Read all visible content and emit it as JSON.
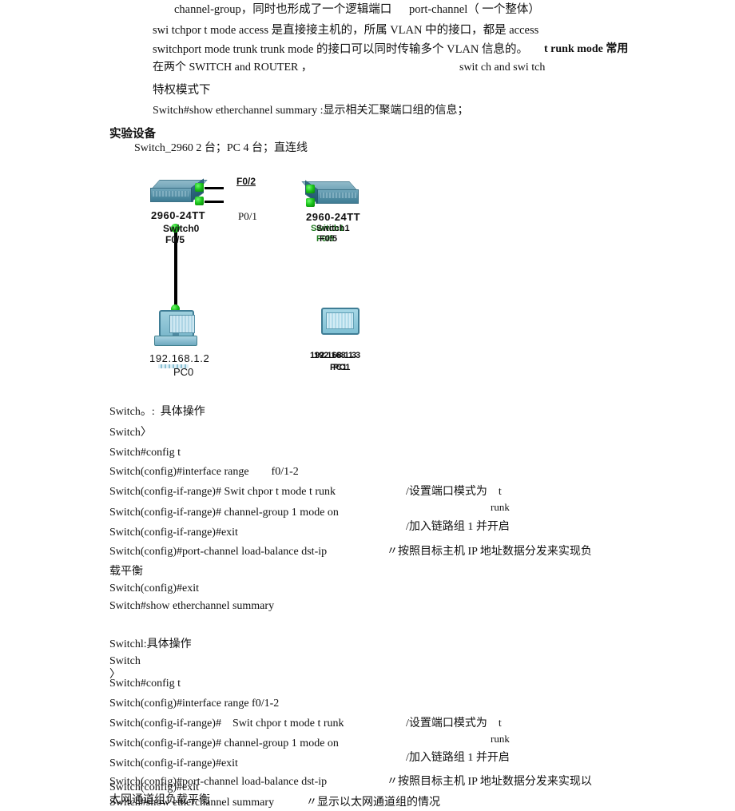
{
  "document": {
    "intro_paragraph": [
      {
        "id": "p1",
        "text": "channel-group，同时也形成了一个逻辑端口      port-channel（ 一个整体）"
      },
      {
        "id": "p2",
        "text": "swi tchpor t mode access 是直接接主机的，所属 VLAN 中的接口，都是 access"
      },
      {
        "id": "p3a",
        "text": "switchport mode trunk trunk mode 的接口可以同时传输多个 VLAN 信息的。"
      },
      {
        "id": "p3b",
        "text": "t runk mode 常用"
      },
      {
        "id": "p4a",
        "text": "在两个 SWITCH and ROUTER ，"
      },
      {
        "id": "p4b",
        "text": "swit ch and swi tch"
      },
      {
        "id": "p5",
        "text": "特权模式下"
      },
      {
        "id": "p6",
        "text": "Switch#show etherchannel summary :显示相关汇聚端口组的信息；"
      }
    ],
    "equipment_heading": "实验设备",
    "equipment_list": "Switch_2960 2 台；PC 4 台；直连线"
  },
  "diagram": {
    "link_labels": {
      "f0_2": "F0/2",
      "p0_1": "P0/1"
    },
    "switch0": {
      "model": "2960-24TT",
      "name": "Switch0",
      "port": "F0/5"
    },
    "switch1": {
      "model": "2960-24TT",
      "name": "Switch1",
      "name_overlap": "Switch1",
      "port": "F0/5",
      "port_overlap": "F0/5"
    },
    "pc0": {
      "ip": "192.168.1.2",
      "name": "PC0"
    },
    "pc1": {
      "ip": "192.168.1.3",
      "ip_overlap": "192.168.1.3",
      "name": "PC1",
      "name_overlap": "PC1"
    }
  },
  "block1": {
    "heading": "Switch。:  具体操作",
    "lines": [
      {
        "cmd": "Switch〉",
        "note": ""
      },
      {
        "cmd": "Switch#config t",
        "note": ""
      },
      {
        "cmd": "Switch(config)#interface range        f0/1-2",
        "note": ""
      },
      {
        "cmd": "Switch(config-if-range)# Swit chpor t mode t runk",
        "note": "/设置端口模式为    t"
      },
      {
        "cmd": "",
        "note": "runk"
      },
      {
        "cmd": "Switch(config-if-range)# channel-group 1 mode on",
        "note": ""
      },
      {
        "cmd": "Switch(config-if-range)#exit",
        "note": "/加入链路组 1 并开启"
      },
      {
        "cmd": "Switch(config)#port-channel load-balance dst-ip",
        "note": "〃按照目标主机 IP 地址数据分发来实现负"
      },
      {
        "cmd": "载平衡",
        "note": ""
      },
      {
        "cmd": "Switch(config)#exit",
        "note": ""
      },
      {
        "cmd": "Switch#show etherchannel summary",
        "note": ""
      }
    ]
  },
  "block2": {
    "heading": "Switchl:具体操作",
    "lines": [
      {
        "cmd": "Switch",
        "note": ""
      },
      {
        "cmd": "〉",
        "note": ""
      },
      {
        "cmd": "Switch#config t",
        "note": ""
      },
      {
        "cmd": "Switch(config)#interface range f0/1-2",
        "note": ""
      },
      {
        "cmd": "Switch(config-if-range)#    Swit chpor t mode t runk",
        "note": "/设置端口模式为    t"
      },
      {
        "cmd": "",
        "note": "runk"
      },
      {
        "cmd": "Switch(config-if-range)# channel-group 1 mode on",
        "note": ""
      },
      {
        "cmd": "Switch(config-if-range)#exit",
        "note": "/加入链路组 1 并开启"
      },
      {
        "cmd": "Switch(config)#port-channel load-balance dst-ip",
        "note": "〃按照目标主机 IP 地址数据分发来实现以"
      },
      {
        "cmd": "Switch(config)#exit",
        "note": ""
      },
      {
        "cmd": "太网通道组负载平衡",
        "note": ""
      },
      {
        "cmd": "Switch#show etherchannel summary",
        "note": "〃显示以太网通道组的情况"
      }
    ]
  }
}
